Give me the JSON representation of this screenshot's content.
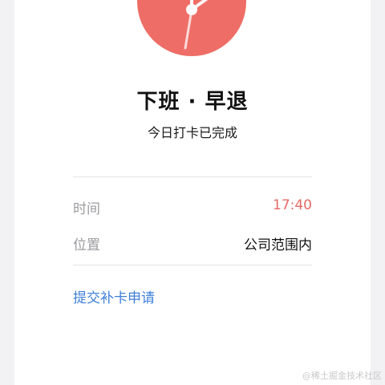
{
  "status": {
    "title": "下班 · 早退",
    "subtitle": "今日打卡已完成"
  },
  "details": {
    "time_label": "时间",
    "time_value": "17:40",
    "location_label": "位置",
    "location_value": "公司范围内"
  },
  "actions": {
    "reissue_link": "提交补卡申请"
  },
  "watermark": "@稀土掘金技术社区",
  "colors": {
    "clock_face": "#ee6e67",
    "time_value": "#e66a64",
    "link": "#3e7fd9"
  },
  "icons": {
    "clock": "clock-icon"
  }
}
